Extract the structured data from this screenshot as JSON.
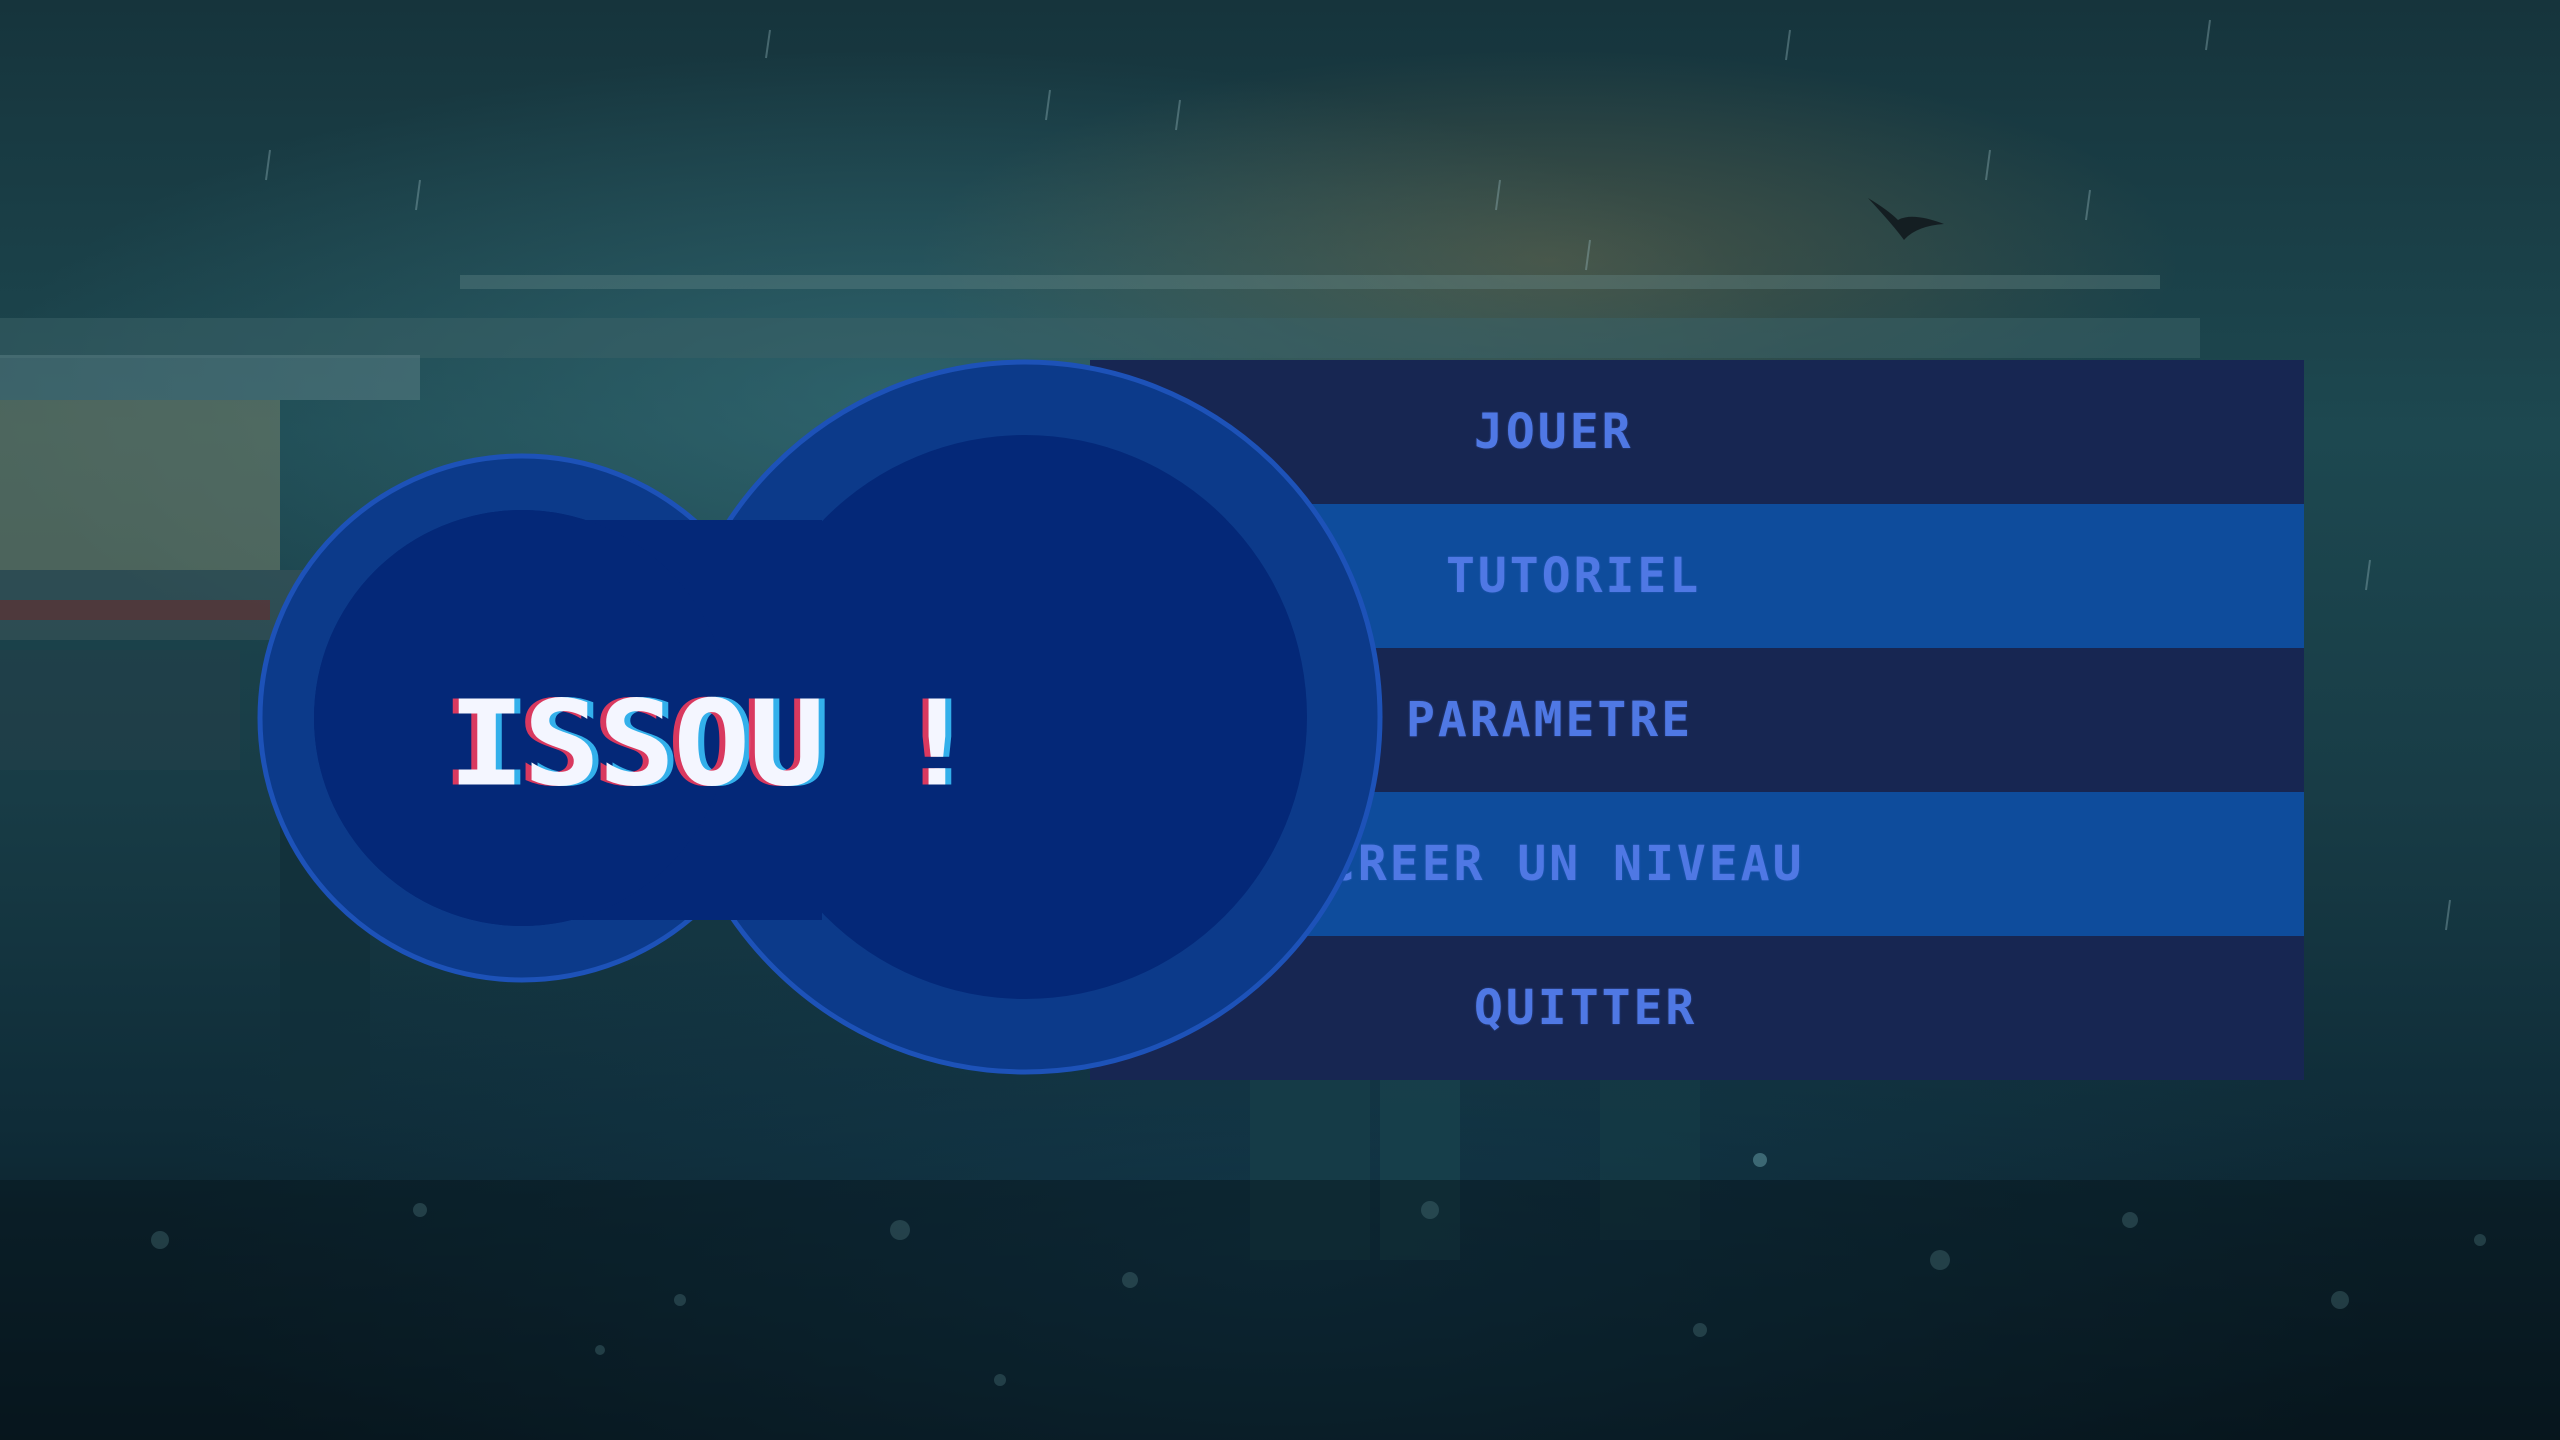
{
  "game": {
    "title": "ISSOU !"
  },
  "menu": {
    "items": [
      {
        "label": "JOUER"
      },
      {
        "label": "TUTORIEL"
      },
      {
        "label": "PARAMETRE"
      },
      {
        "label": "CREER UN NIVEAU"
      },
      {
        "label": "QUITTER"
      }
    ]
  },
  "colors": {
    "row_dark": "#172652",
    "row_light": "#0e4c9c",
    "label": "#4f78e4",
    "circle_outer": "#0c3a8a",
    "circle_inner": "#042878",
    "title": "#f4f6ff"
  }
}
